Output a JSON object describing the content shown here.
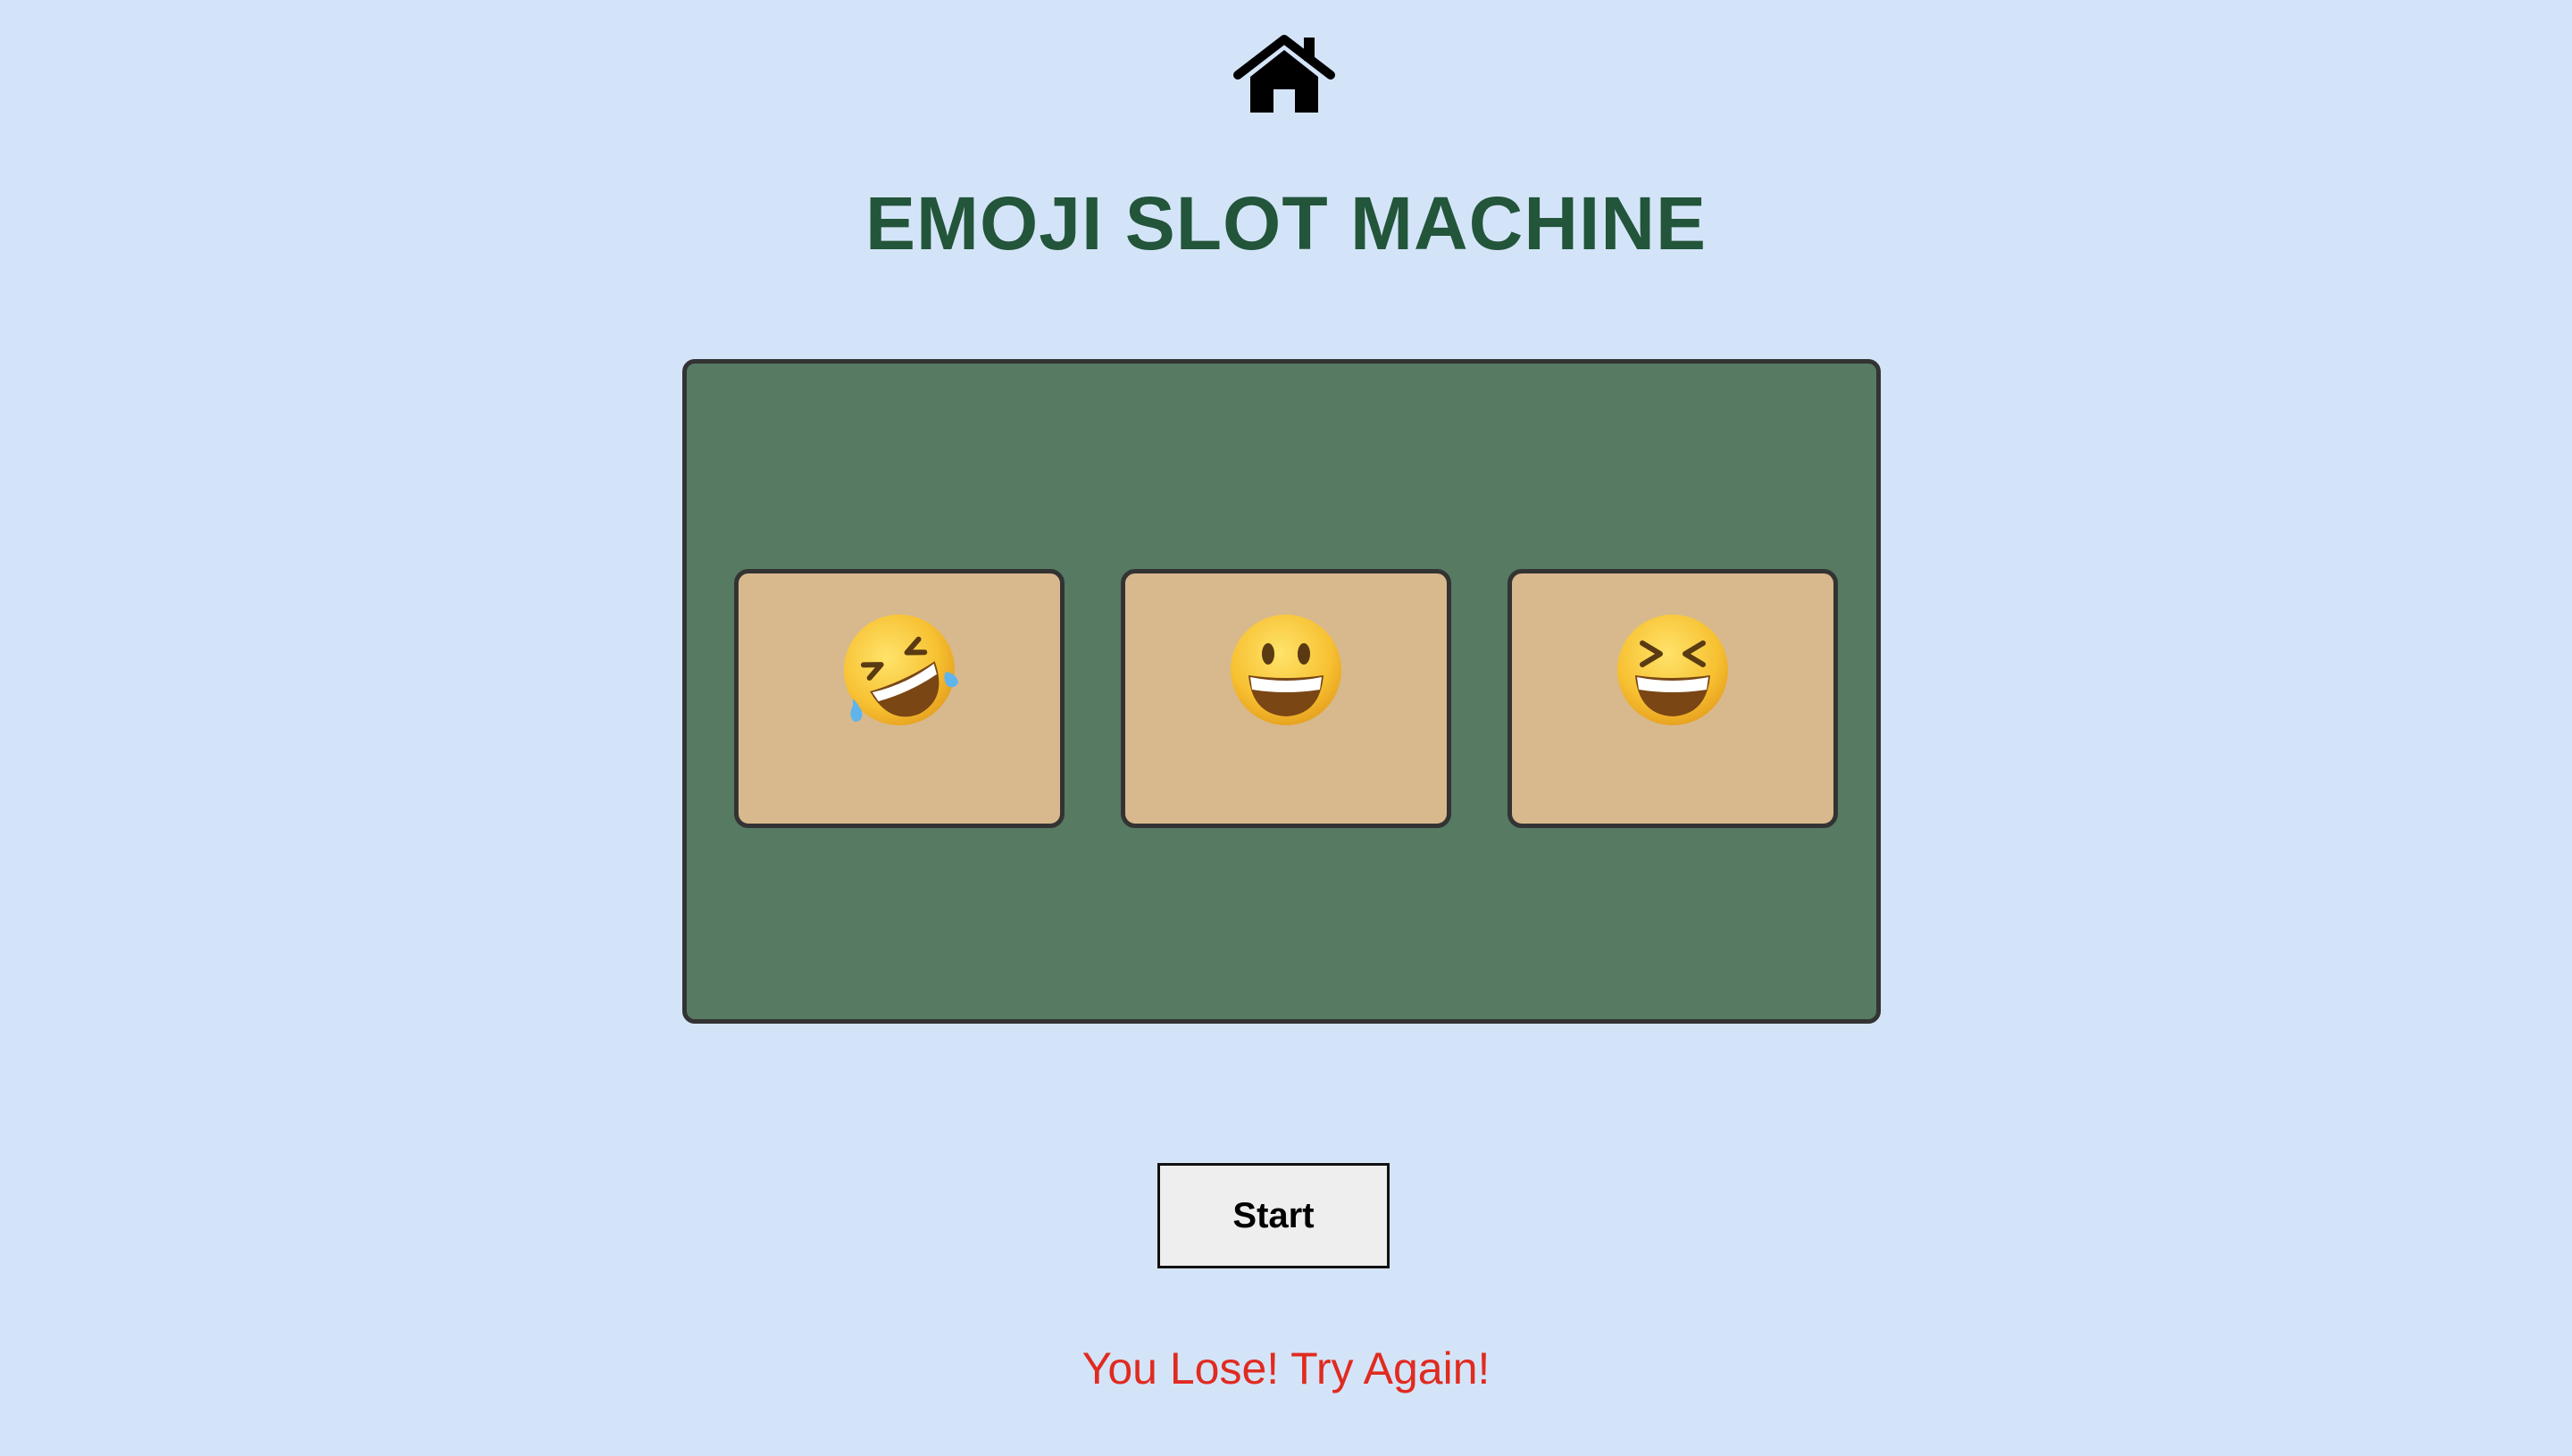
{
  "header": {
    "home_icon": "home-icon",
    "title": "EMOJI SLOT MACHINE"
  },
  "machine": {
    "reels": [
      {
        "emoji": "🤣",
        "icon": "rolling-on-floor-laughing-icon"
      },
      {
        "emoji": "😀",
        "icon": "grinning-face-icon"
      },
      {
        "emoji": "😆",
        "icon": "grinning-squinting-face-icon"
      }
    ]
  },
  "controls": {
    "start_label": "Start"
  },
  "status": {
    "message": "You Lose! Try Again!"
  },
  "colors": {
    "background": "#d4e4f8",
    "title": "#22553a",
    "machine": "#567a62",
    "reel": "#d8b98d",
    "message": "#e02b20"
  }
}
